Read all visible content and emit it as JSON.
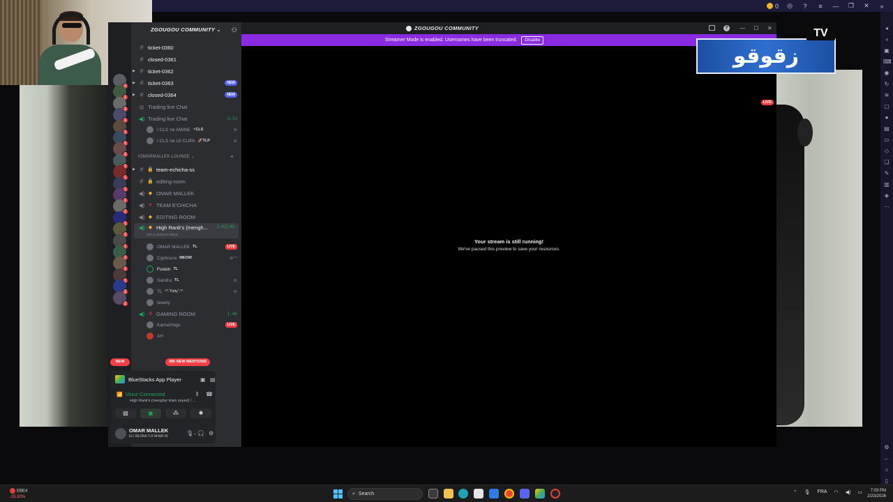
{
  "bluestacks": {
    "coins": "0"
  },
  "overlay": {
    "arabic_logo": "زقوقو",
    "tv_label": "TV"
  },
  "discord": {
    "window_title": "ZGOUGOU COMMUNITY",
    "streamer_notice": "Streamer Mode is enabled. Usernames have been truncated.",
    "disable_label": "Disable",
    "server_name": "ZGOUGOU COMMUNITY",
    "server_badges": [
      "2",
      "1",
      "2",
      "1",
      "1",
      "1",
      "2",
      "1",
      "1",
      "1",
      "1",
      "2",
      "1",
      "2",
      "1",
      "2",
      "1",
      "1",
      "2",
      "2"
    ],
    "new_label": "NEW",
    "channels": {
      "c0": "ticket-0360",
      "c1": "closed-0361",
      "c2": "ticket-0362",
      "c3": "ticket-0363",
      "c4": "closed-0364",
      "c5": "Trading live Chat",
      "c6": "Trading live Chat",
      "c6_timer": "3:31",
      "new": "NEW"
    },
    "trading_users": {
      "u1": "I CLS ᴛᴍ AMINE",
      "u1_tag": "⚡CLS",
      "u2": "I CLS ᴛᴍ L8 CLIPA",
      "u2_tag": "🚀TLP"
    },
    "category": "IOMARMALLEK LOUNGE",
    "lounge": {
      "team": "team-echicha-ss",
      "editing": "editing-room",
      "omar": "OMAR MALLEK",
      "team_vc": "TEAM E'CHICHA",
      "editing_vc": "EDITING ROOM",
      "high": "High Rank's (mengh...",
      "high_timer": "2:02:49",
      "status": "Set a channel status",
      "gaming": "GAMING ROOM",
      "gaming_timer": "1:40"
    },
    "vc_users": {
      "omar": "OMAR MALLEK",
      "omar_tag": "TL",
      "cyphoura": "Cyphoura",
      "cyphoura_tag": "MEOW",
      "fusion": "Fusion",
      "fusion_tag": "TL",
      "sandra": "Sandra",
      "sandra_tag": "TL",
      "tl": "TL",
      "tl_tag": "ᵒ*.˚Kitty˚.*ᵒ",
      "tweety": "tweety",
      "kama": "KamaVingo",
      "ah": "AH"
    },
    "live_label": "LIVE",
    "mentions": "495 NEW MENTIONS",
    "activity": "BlueStacks App Player",
    "voice_connected": "Voice Connected",
    "voice_channel": "High Rank's (menghyr kiam zeyed) / ...",
    "user_name": "OMAR MALLEK",
    "user_status": "ELI BESNA YJI NHAR W",
    "stream_live": "LIVE",
    "stream_title": "Your stream is still running!",
    "stream_sub": "We've paused this preview to save your resources."
  },
  "taskbar": {
    "weather_label": "EBE4",
    "weather_value": "-25.93%",
    "search": "Search",
    "lang": "FRA",
    "time": "7:03 PM",
    "date": "2/23/2026"
  }
}
